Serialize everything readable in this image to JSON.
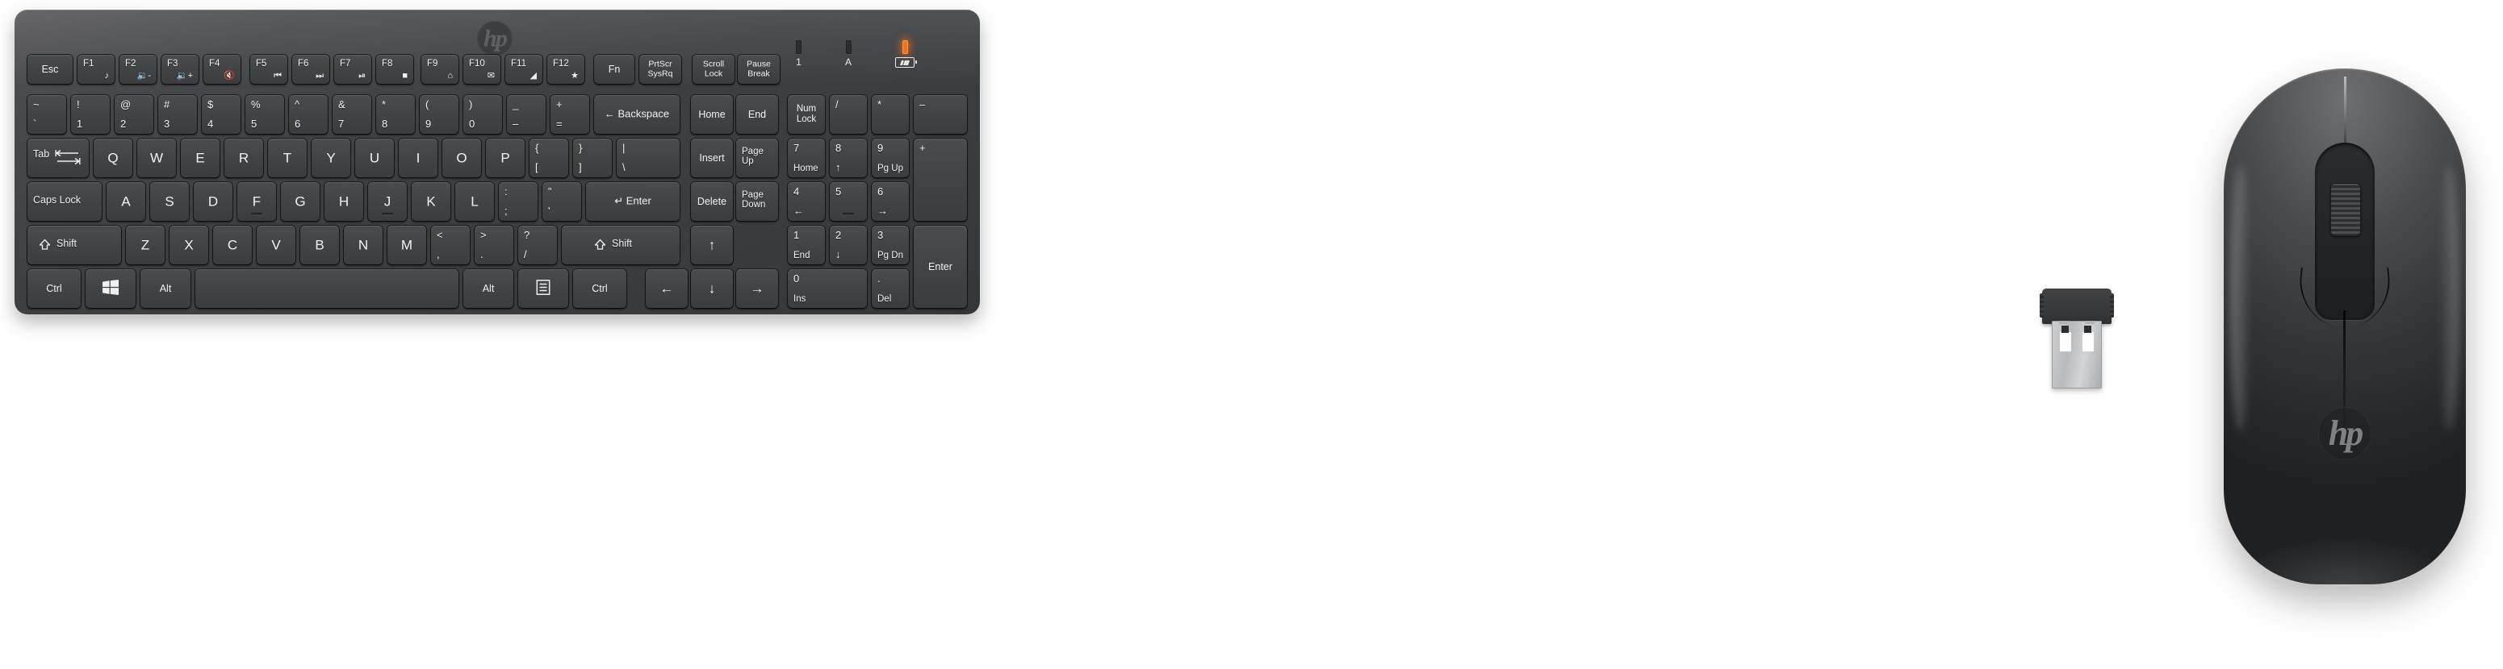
{
  "product": {
    "brand": "hp",
    "brand_logo_text": "hp",
    "items": [
      "keyboard",
      "wireless-usb-receiver",
      "mouse"
    ]
  },
  "keyboard": {
    "indicators": [
      {
        "name": "num-lock-indicator",
        "caption": "1",
        "lit": false
      },
      {
        "name": "caps-lock-indicator",
        "caption": "A",
        "lit": false
      },
      {
        "name": "battery-indicator",
        "caption": "",
        "lit": true,
        "color": "#f2711c"
      }
    ],
    "rows": {
      "function_row": [
        {
          "main": "Esc",
          "fn": ""
        },
        {
          "main": "F1",
          "fn": "♪"
        },
        {
          "main": "F2",
          "fn": "🔉-"
        },
        {
          "main": "F3",
          "fn": "🔉+"
        },
        {
          "main": "F4",
          "fn": "🔇"
        },
        {
          "main": "F5",
          "fn": "⏮"
        },
        {
          "main": "F6",
          "fn": "⏭"
        },
        {
          "main": "F7",
          "fn": "⏯"
        },
        {
          "main": "F8",
          "fn": "■"
        },
        {
          "main": "F9",
          "fn": "⌂"
        },
        {
          "main": "F10",
          "fn": "✉"
        },
        {
          "main": "F11",
          "fn": "◢"
        },
        {
          "main": "F12",
          "fn": "★"
        },
        {
          "main": "Fn",
          "fn": ""
        },
        {
          "main": "PrtScr\nSysRq",
          "fn": ""
        },
        {
          "main": "Scroll\nLock",
          "fn": ""
        },
        {
          "main": "Pause\nBreak",
          "fn": ""
        }
      ],
      "number_row": [
        {
          "top": "~",
          "bottom": "`"
        },
        {
          "top": "!",
          "bottom": "1"
        },
        {
          "top": "@",
          "bottom": "2"
        },
        {
          "top": "#",
          "bottom": "3"
        },
        {
          "top": "$",
          "bottom": "4"
        },
        {
          "top": "%",
          "bottom": "5"
        },
        {
          "top": "^",
          "bottom": "6"
        },
        {
          "top": "&",
          "bottom": "7"
        },
        {
          "top": "*",
          "bottom": "8"
        },
        {
          "top": "(",
          "bottom": "9"
        },
        {
          "top": ")",
          "bottom": "0"
        },
        {
          "top": "_",
          "bottom": "–"
        },
        {
          "top": "+",
          "bottom": "="
        },
        {
          "top": "",
          "bottom": "",
          "label": "← Backspace"
        }
      ],
      "tab_row": [
        {
          "label": "Tab"
        },
        {
          "label": "Q"
        },
        {
          "label": "W"
        },
        {
          "label": "E"
        },
        {
          "label": "R"
        },
        {
          "label": "T"
        },
        {
          "label": "Y"
        },
        {
          "label": "U"
        },
        {
          "label": "I"
        },
        {
          "label": "O"
        },
        {
          "label": "P"
        },
        {
          "top": "{",
          "bottom": "["
        },
        {
          "top": "}",
          "bottom": "]"
        },
        {
          "top": "|",
          "bottom": "\\"
        }
      ],
      "caps_row": [
        {
          "label": "Caps Lock"
        },
        {
          "label": "A"
        },
        {
          "label": "S"
        },
        {
          "label": "D"
        },
        {
          "label": "F"
        },
        {
          "label": "G"
        },
        {
          "label": "H"
        },
        {
          "label": "J"
        },
        {
          "label": "K"
        },
        {
          "label": "L"
        },
        {
          "top": ":",
          "bottom": ";"
        },
        {
          "top": "\"",
          "bottom": "'"
        },
        {
          "label": "↵ Enter"
        }
      ],
      "shift_row": [
        {
          "label": "Shift"
        },
        {
          "label": "Z"
        },
        {
          "label": "X"
        },
        {
          "label": "C"
        },
        {
          "label": "V"
        },
        {
          "label": "B"
        },
        {
          "label": "N"
        },
        {
          "label": "M"
        },
        {
          "top": "<",
          "bottom": ","
        },
        {
          "top": ">",
          "bottom": "."
        },
        {
          "top": "?",
          "bottom": "/"
        },
        {
          "label": "Shift"
        }
      ],
      "bottom_row": [
        {
          "label": "Ctrl"
        },
        {
          "label": "windows-key"
        },
        {
          "label": "Alt"
        },
        {
          "label": "space"
        },
        {
          "label": "Alt"
        },
        {
          "label": "menu-key"
        },
        {
          "label": "Ctrl"
        }
      ],
      "arrows": [
        "↑",
        "←",
        "↓",
        "→"
      ],
      "nav_cluster": [
        {
          "label": "Home"
        },
        {
          "label": "End"
        },
        {
          "label": "Insert"
        },
        {
          "label": "Page\nUp"
        },
        {
          "label": "Delete"
        },
        {
          "label": "Page\nDown"
        }
      ],
      "numpad": [
        {
          "main": "Num\nLock"
        },
        {
          "main": "/"
        },
        {
          "main": "*"
        },
        {
          "main": "–"
        },
        {
          "main": "7",
          "sub": "Home"
        },
        {
          "main": "8",
          "sub": "↑"
        },
        {
          "main": "9",
          "sub": "Pg Up"
        },
        {
          "main": "+"
        },
        {
          "main": "4",
          "sub": "←"
        },
        {
          "main": "5",
          "sub": ""
        },
        {
          "main": "6",
          "sub": "→"
        },
        {
          "main": "1",
          "sub": "End"
        },
        {
          "main": "2",
          "sub": "↓"
        },
        {
          "main": "3",
          "sub": "Pg Dn"
        },
        {
          "main": "Enter"
        },
        {
          "main": "0",
          "sub": "Ins"
        },
        {
          "main": ".",
          "sub": "Del"
        }
      ]
    }
  },
  "receiver": {
    "name": "usb-nano-receiver"
  },
  "mouse": {
    "name": "wireless-mouse",
    "logo": "hp",
    "buttons": [
      "left",
      "right",
      "scroll-wheel"
    ]
  }
}
